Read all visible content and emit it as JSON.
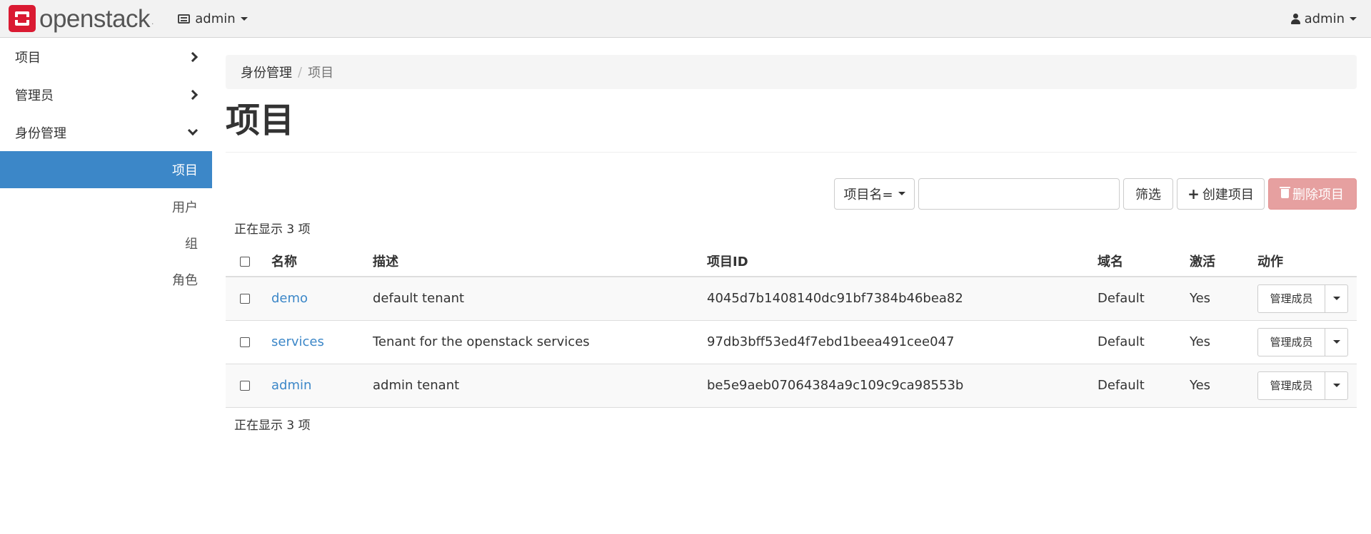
{
  "navbar": {
    "brand": "openstack",
    "brand_tm": ".",
    "project": "admin",
    "user": "admin"
  },
  "sidebar": {
    "panels": [
      {
        "label": "项目",
        "state": "collapsed"
      },
      {
        "label": "管理员",
        "state": "collapsed"
      },
      {
        "label": "身份管理",
        "state": "expanded"
      }
    ],
    "items": [
      {
        "label": "项目",
        "active": true
      },
      {
        "label": "用户",
        "active": false
      },
      {
        "label": "组",
        "active": false
      },
      {
        "label": "角色",
        "active": false
      }
    ]
  },
  "breadcrumb": {
    "parent": "身份管理",
    "separator": "/",
    "current": "项目"
  },
  "page_title": "项目",
  "toolbar": {
    "filter_field": "项目名=",
    "filter_value": "",
    "filter_button": "筛选",
    "create_button": "创建项目",
    "delete_button": "删除项目"
  },
  "count_text": "正在显示 3 项",
  "table": {
    "columns": [
      "名称",
      "描述",
      "项目ID",
      "域名",
      "激活",
      "动作"
    ],
    "rows": [
      {
        "name": "demo",
        "description": "default tenant",
        "id": "4045d7b1408140dc91bf7384b46bea82",
        "domain": "Default",
        "enabled": "Yes",
        "action": "管理成员"
      },
      {
        "name": "services",
        "description": "Tenant for the openstack services",
        "id": "97db3bff53ed4f7ebd1beea491cee047",
        "domain": "Default",
        "enabled": "Yes",
        "action": "管理成员"
      },
      {
        "name": "admin",
        "description": "admin tenant",
        "id": "be5e9aeb07064384a9c109c9ca98553b",
        "domain": "Default",
        "enabled": "Yes",
        "action": "管理成员"
      }
    ]
  },
  "colors": {
    "accent": "#3c87c8",
    "brand": "#da1a32",
    "danger_disabled": "#e6a0a0"
  }
}
